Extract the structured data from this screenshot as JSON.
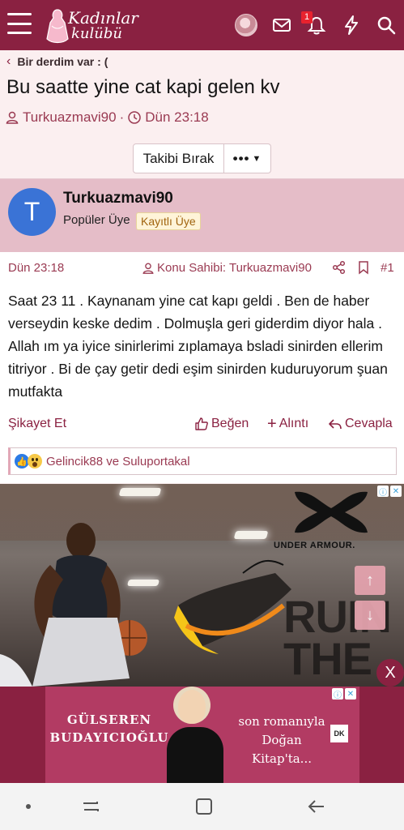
{
  "header": {
    "logo_line1": "Kadınlar",
    "logo_line2": "kulübü",
    "notification_count": "1",
    "icons": [
      "menu-icon",
      "avatar",
      "mail-icon",
      "bell-icon",
      "bolt-icon",
      "search-icon"
    ],
    "brand_color": "#8a2141"
  },
  "breadcrumb": {
    "label": "Bir derdim var : ("
  },
  "thread": {
    "title": "Bu saatte yine cat kapi gelen kv",
    "author": "Turkuazmavi90",
    "time": "Dün 23:18",
    "separator": "·",
    "follow_label": "Takibi Bırak",
    "more_label": "•••"
  },
  "post": {
    "avatar_letter": "T",
    "username": "Turkuazmavi90",
    "user_title": "Popüler Üye",
    "user_badge": "Kayıtlı Üye",
    "date": "Dün 23:18",
    "author_label": "Konu Sahibi: Turkuazmavi90",
    "number": "#1",
    "body": "Saat 23 11 . Kaynanam yine cat kapı geldi . Ben de haber verseydin keske dedim . Dolmuşla geri giderdim diyor hala . Allah ım ya iyice sinirlerimi zıplamaya bsladi sinirden ellerim titriyor . Bi de çay getir dedi eşim sinirden kuduruyorum şuan mutfakta",
    "actions": {
      "report": "Şikayet Et",
      "like": "Beğen",
      "quote": "Alıntı",
      "reply": "Cevapla"
    },
    "reactions_text": "Gelincik88 ve Suluportakal"
  },
  "ads": {
    "ad1_brand": "UNDER ARMOUR.",
    "ad1_slogan_line1": "RUIN",
    "ad1_slogan_line2": "THE",
    "ad1_close": "X",
    "ad2_left_line1": "GÜLSEREN",
    "ad2_left_line2": "BUDAYICIOĞLU",
    "ad2_right_line1": "son romanıyla",
    "ad2_right_line2": "Doğan Kitap'ta...",
    "ad2_badge": "DK"
  }
}
